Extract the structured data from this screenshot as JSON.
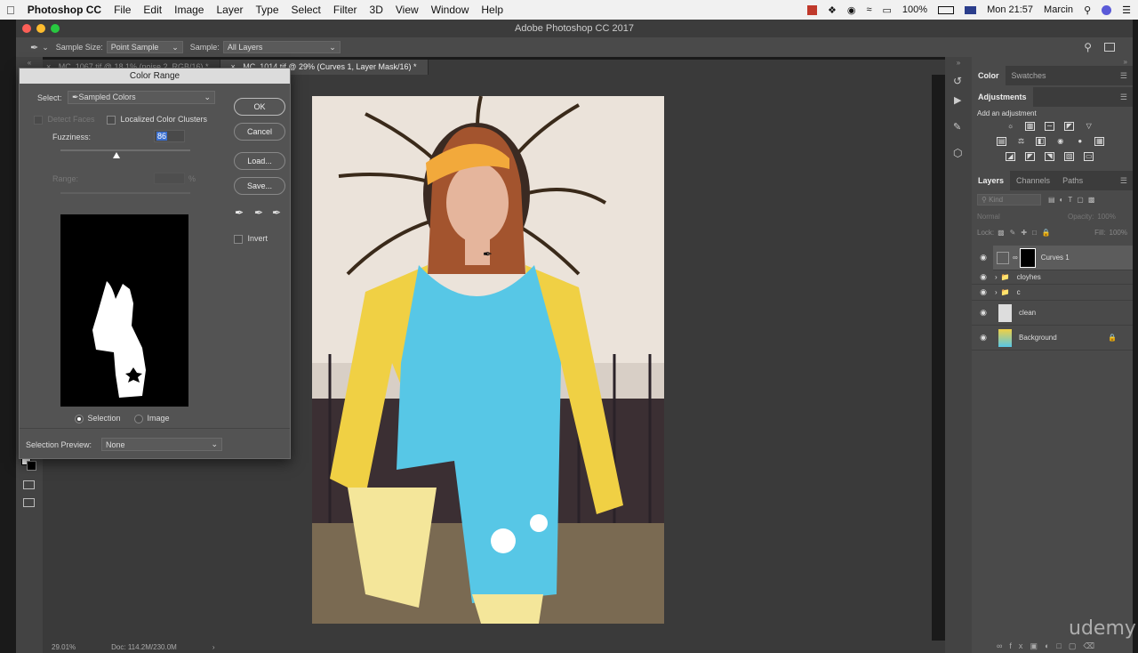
{
  "menubar": {
    "items": [
      "Photoshop CC",
      "File",
      "Edit",
      "Image",
      "Layer",
      "Type",
      "Select",
      "Filter",
      "3D",
      "View",
      "Window",
      "Help"
    ],
    "battery": "100%",
    "clock": "Mon 21:57",
    "user": "Marcin"
  },
  "window": {
    "title": "Adobe Photoshop CC 2017"
  },
  "options": {
    "sample_size_label": "Sample Size:",
    "sample_size_value": "Point Sample",
    "sample_label": "Sample:",
    "sample_value": "All Layers"
  },
  "doc_tabs": [
    {
      "label": "MC_1067.tif @ 18.1% (noise 2, RGB/16) *",
      "active": false
    },
    {
      "label": "MC_1014.tif @ 29% (Curves 1, Layer Mask/16) *",
      "active": true
    }
  ],
  "status": {
    "zoom": "29.01%",
    "doc": "Doc: 114.2M/230.0M"
  },
  "dialog": {
    "title": "Color Range",
    "select_label": "Select:",
    "select_value": "Sampled Colors",
    "detect_faces": "Detect Faces",
    "localized_clusters": "Localized Color Clusters",
    "fuzziness_label": "Fuzziness:",
    "fuzziness_value": "86",
    "fuzziness_level": 0.43,
    "range_label": "Range:",
    "range_unit": "%",
    "ok": "OK",
    "cancel": "Cancel",
    "load": "Load...",
    "save": "Save...",
    "invert": "Invert",
    "selection": "Selection",
    "image": "Image",
    "preview_label": "Selection Preview:",
    "preview_value": "None"
  },
  "panels": {
    "top_tabs": [
      "Color",
      "Swatches"
    ],
    "adjustments_tab": "Adjustments",
    "add_adjustment": "Add an adjustment",
    "layer_tabs": [
      "Layers",
      "Channels",
      "Paths"
    ],
    "kind_placeholder": "Kind",
    "blend_mode": "Normal",
    "opacity_label": "Opacity:",
    "opacity_value": "100%",
    "lock_label": "Lock:",
    "fill_label": "Fill:",
    "fill_value": "100%",
    "layers": [
      {
        "name": "Curves 1",
        "selected": true
      },
      {
        "name": "cloyhes",
        "selected": false
      },
      {
        "name": "c",
        "selected": false
      },
      {
        "name": "clean",
        "selected": false
      },
      {
        "name": "Background",
        "selected": false
      }
    ]
  },
  "watermark": "udemy"
}
